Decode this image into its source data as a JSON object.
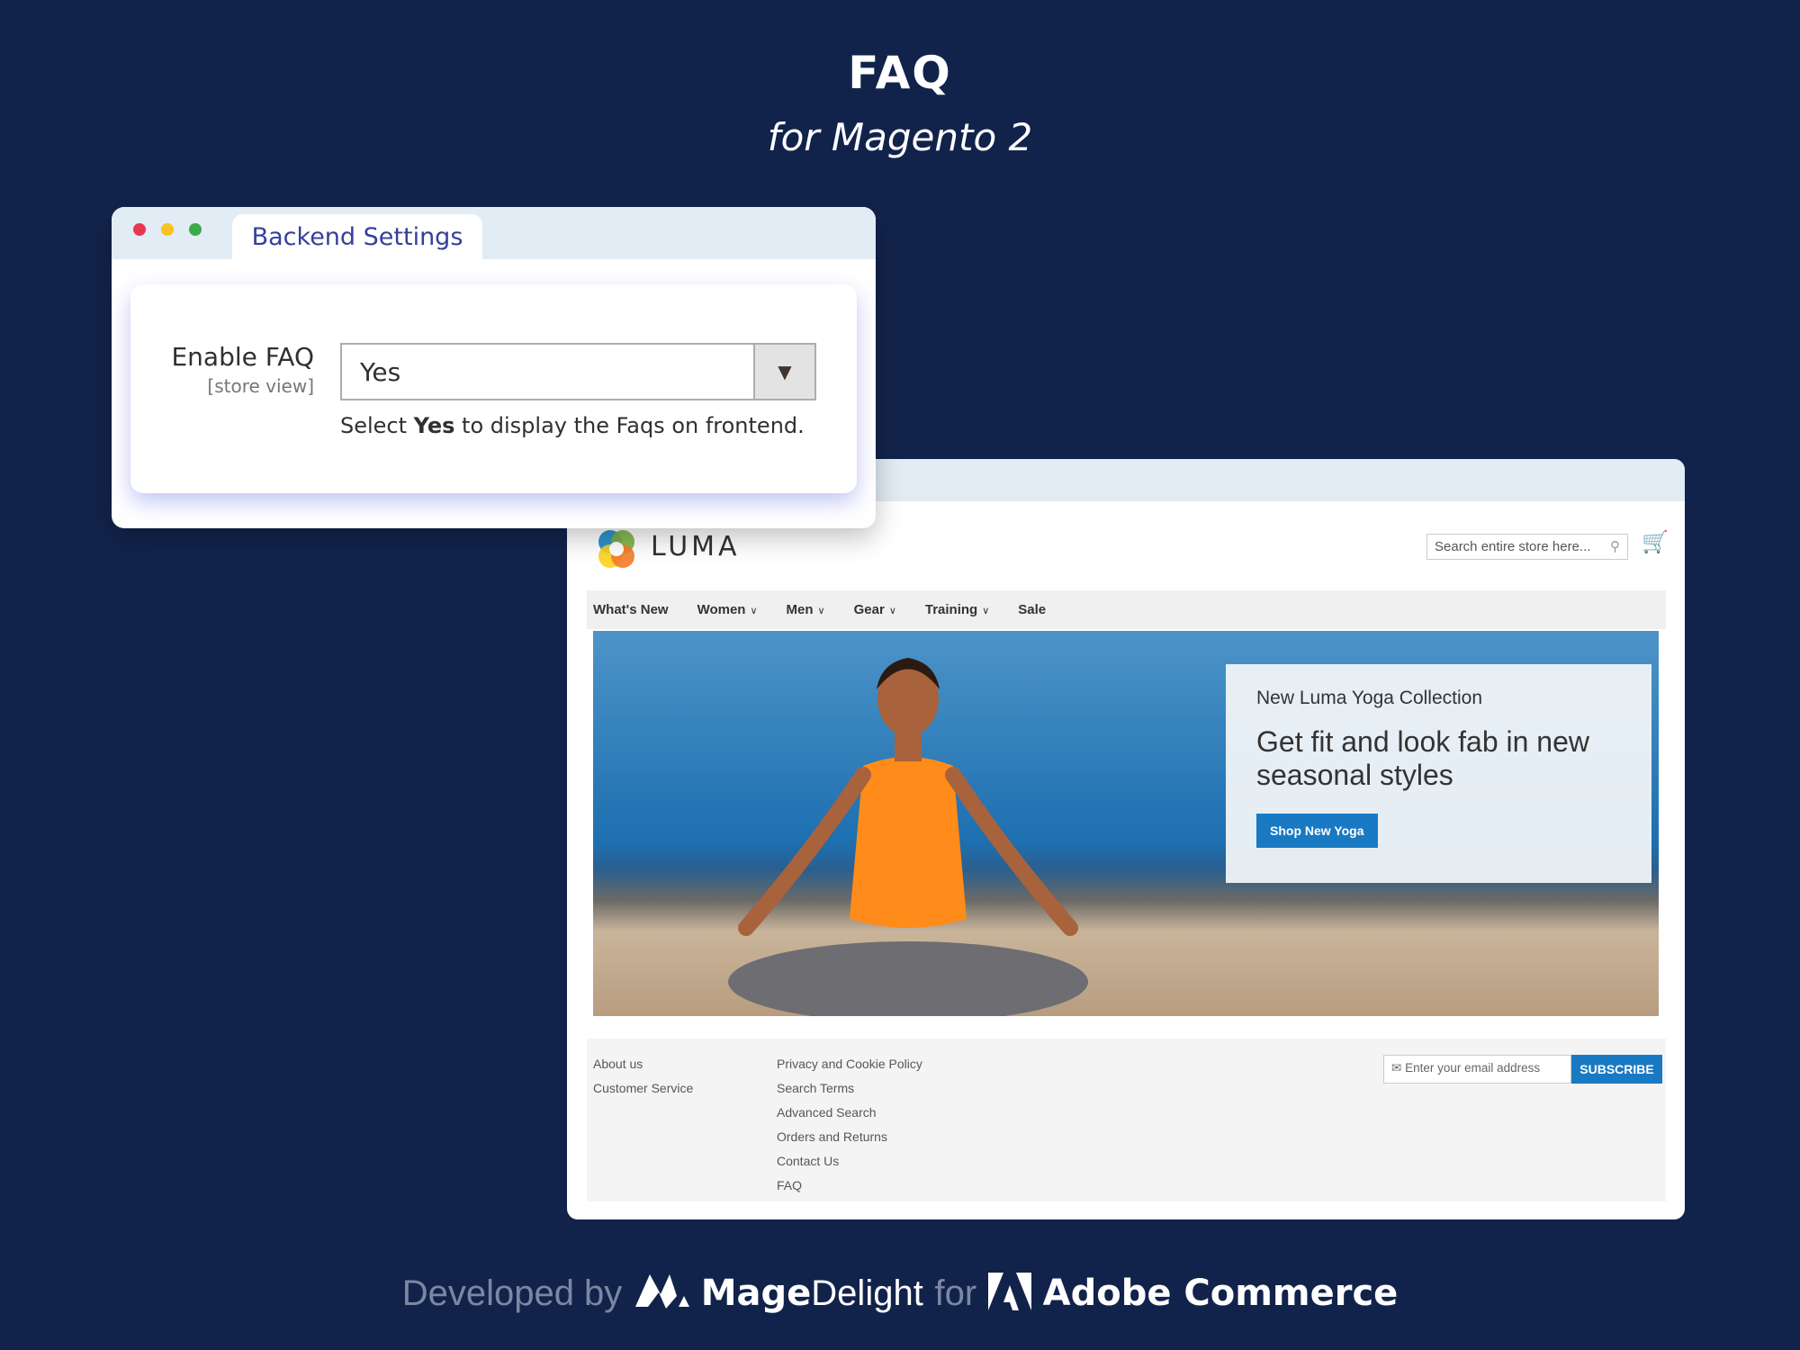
{
  "header": {
    "title": "FAQ",
    "subtitle": "for Magento 2"
  },
  "backend": {
    "tab": "Backend Settings",
    "field_label": "Enable FAQ",
    "scope": "[store view]",
    "select_value": "Yes",
    "help_pre": "Select ",
    "help_bold": "Yes",
    "help_post": " to display the Faqs on frontend.",
    "dots": [
      "#e8374f",
      "#f7c325",
      "#3daa48"
    ]
  },
  "frontend": {
    "logo_text": "LUMA",
    "search_placeholder": "Search entire store here...",
    "nav": [
      {
        "label": "What's New",
        "dropdown": false
      },
      {
        "label": "Women",
        "dropdown": true
      },
      {
        "label": "Men",
        "dropdown": true
      },
      {
        "label": "Gear",
        "dropdown": true
      },
      {
        "label": "Training",
        "dropdown": true
      },
      {
        "label": "Sale",
        "dropdown": false
      }
    ],
    "hero": {
      "subtitle": "New Luma Yoga Collection",
      "headline": "Get fit and look fab in new seasonal styles",
      "button": "Shop New Yoga"
    },
    "footer": {
      "col1": [
        "About us",
        "Customer Service"
      ],
      "col2": [
        "Privacy and Cookie Policy",
        "Search Terms",
        "Advanced Search",
        "Orders and Returns",
        "Contact Us",
        "FAQ"
      ],
      "email_placeholder": "Enter your email address",
      "subscribe": "SUBSCRIBE"
    },
    "accent": "#1979c3"
  },
  "credit": {
    "developed": "Developed by",
    "brand_bold": "Mage",
    "brand_light": "Delight",
    "for": "for",
    "platform": "Adobe Commerce"
  }
}
